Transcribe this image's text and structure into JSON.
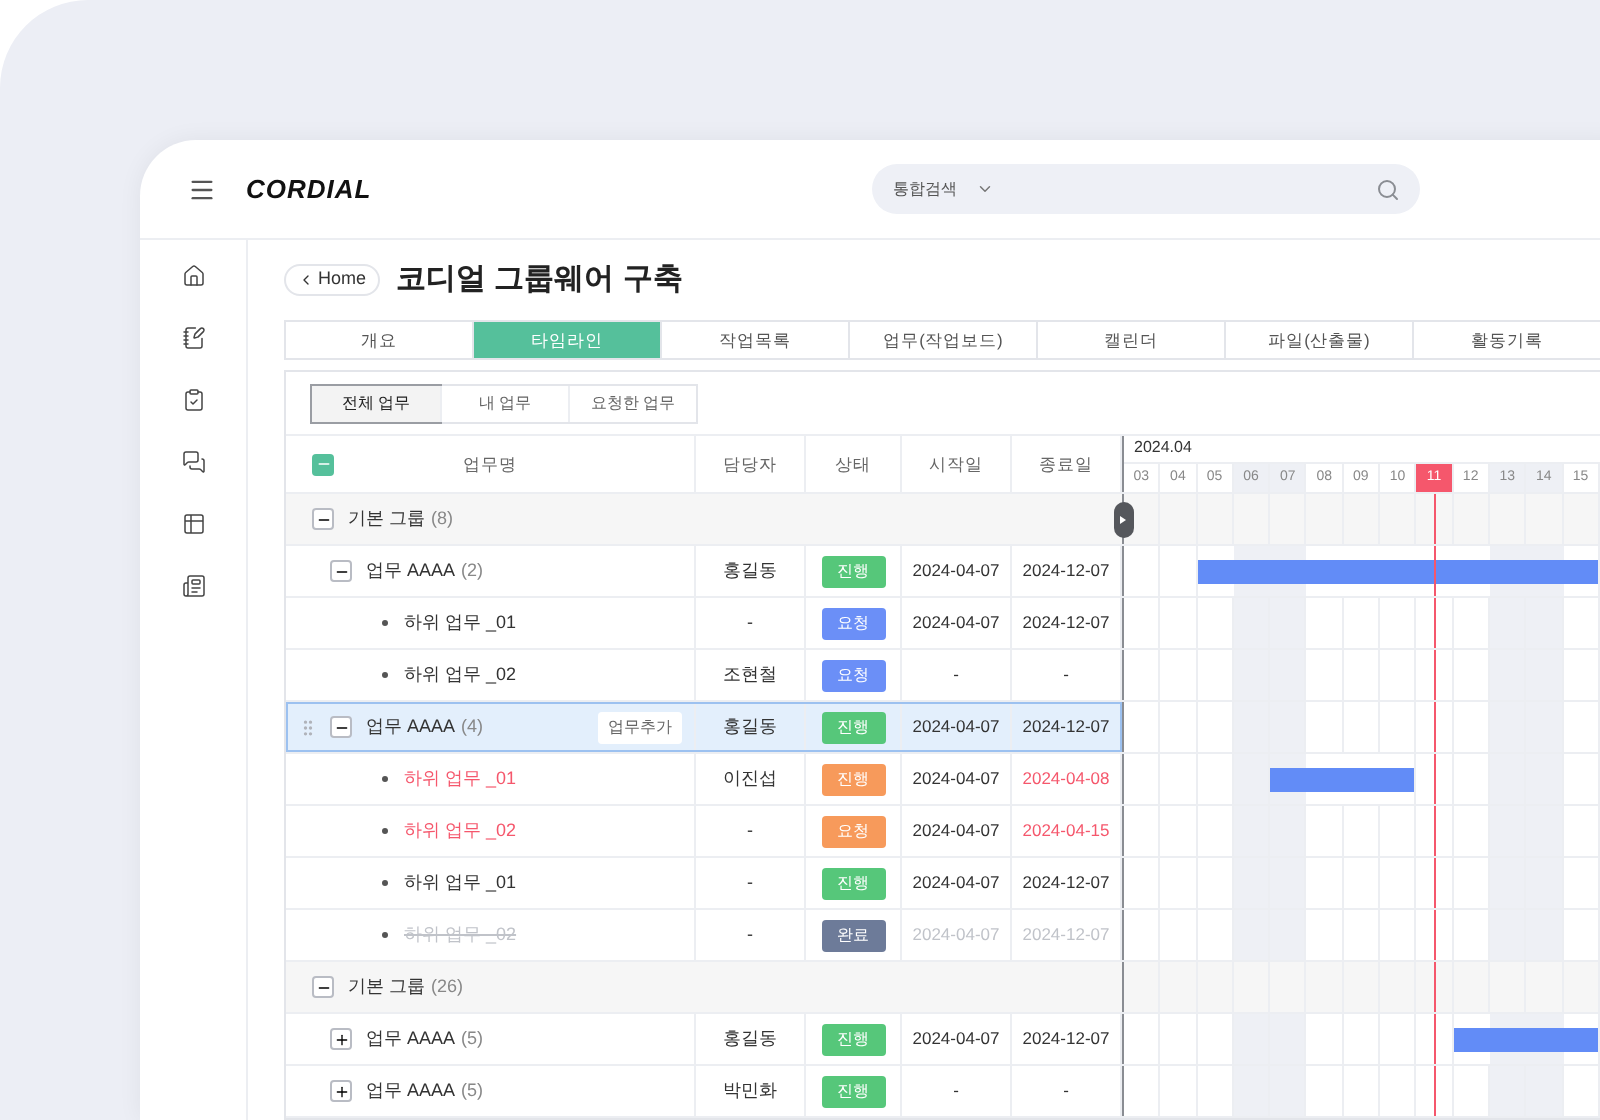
{
  "header": {
    "logo": "CORDIAL",
    "search": {
      "scope": "통합검색"
    }
  },
  "breadcrumb": {
    "back_label": "Home"
  },
  "page_title": "코디얼 그룹웨어 구축",
  "tabs": [
    {
      "label": "개요",
      "selected": false
    },
    {
      "label": "타임라인",
      "selected": true
    },
    {
      "label": "작업목록",
      "selected": false
    },
    {
      "label": "업무(작업보드)",
      "selected": false
    },
    {
      "label": "캘린더",
      "selected": false
    },
    {
      "label": "파일(산출물)",
      "selected": false
    },
    {
      "label": "활동기록",
      "selected": false
    }
  ],
  "filters": [
    {
      "label": "전체 업무",
      "selected": true
    },
    {
      "label": "내 업무",
      "selected": false
    },
    {
      "label": "요청한 업무",
      "selected": false
    }
  ],
  "table": {
    "select_all": {
      "checked": true
    },
    "columns": [
      "업무명",
      "담당자",
      "상태",
      "시작일",
      "종료일"
    ],
    "groups": [
      {
        "name": "기본 그룹",
        "count": "(8)",
        "expanded": true,
        "children": [
          {
            "name": "업무 AAAA",
            "count": "(2)",
            "expanded": true,
            "selected": false,
            "assignee": "홍길동",
            "status": {
              "label": "진행",
              "color": "#56c77a"
            },
            "start": "2024-04-07",
            "end": "2024-12-07",
            "bar": [
              false,
              false,
              true,
              true,
              true,
              true,
              true,
              true,
              true,
              true,
              true,
              true,
              true
            ],
            "children": [
              {
                "name": "하위 업무 _01",
                "selected": false,
                "overdue": false,
                "done": false,
                "assignee": "-",
                "status": {
                  "label": "요청",
                  "color": "#6b8ff7"
                },
                "start": "2024-04-07",
                "end": "2024-12-07"
              },
              {
                "name": "하위 업무 _02",
                "selected": false,
                "overdue": false,
                "done": false,
                "assignee": "조현철",
                "status": {
                  "label": "요청",
                  "color": "#6b8ff7"
                },
                "start": "-",
                "end": "-"
              }
            ]
          },
          {
            "name": "업무 AAAA",
            "count": "(4)",
            "expanded": true,
            "selected": true,
            "add_button": "업무추가",
            "assignee": "홍길동",
            "status": {
              "label": "진행",
              "color": "#56c77a"
            },
            "start": "2024-04-07",
            "end": "2024-12-07",
            "children": [
              {
                "name": "하위 업무 _01",
                "selected": false,
                "overdue": true,
                "done": false,
                "assignee": "이진섭",
                "status": {
                  "label": "진행",
                  "color": "#f79a5b"
                },
                "start": "2024-04-07",
                "end": "2024-04-08",
                "bar": [
                  false,
                  false,
                  false,
                  false,
                  true,
                  true,
                  true,
                  true,
                  false,
                  false,
                  false,
                  false,
                  false
                ]
              },
              {
                "name": "하위 업무 _02",
                "selected": false,
                "overdue": true,
                "done": false,
                "assignee": "-",
                "status": {
                  "label": "요청",
                  "color": "#f79a5b"
                },
                "start": "2024-04-07",
                "end": "2024-04-15"
              },
              {
                "name": "하위 업무 _01",
                "selected": false,
                "overdue": false,
                "done": false,
                "assignee": "-",
                "status": {
                  "label": "진행",
                  "color": "#56c77a"
                },
                "start": "2024-04-07",
                "end": "2024-12-07"
              },
              {
                "name": "하위 업무 _02",
                "selected": false,
                "overdue": false,
                "done": true,
                "assignee": "-",
                "status": {
                  "label": "완료",
                  "color": "#6d7b99"
                },
                "start": "2024-04-07",
                "end": "2024-12-07"
              }
            ]
          }
        ]
      },
      {
        "name": "기본 그룹",
        "count": "(26)",
        "expanded": true,
        "children": [
          {
            "name": "업무 AAAA",
            "count": "(5)",
            "expanded": false,
            "selected": false,
            "assignee": "홍길동",
            "status": {
              "label": "진행",
              "color": "#56c77a"
            },
            "start": "2024-04-07",
            "end": "2024-12-07",
            "bar": [
              false,
              false,
              false,
              false,
              false,
              false,
              false,
              false,
              false,
              true,
              true,
              true,
              true
            ]
          },
          {
            "name": "업무 AAAA",
            "count": "(5)",
            "expanded": false,
            "selected": false,
            "assignee": "박민화",
            "status": {
              "label": "진행",
              "color": "#56c77a"
            },
            "start": "-",
            "end": "-"
          }
        ]
      }
    ]
  },
  "gantt": {
    "month": "2024.04",
    "days": [
      {
        "label": "03",
        "weekend": false,
        "today": false
      },
      {
        "label": "04",
        "weekend": false,
        "today": false
      },
      {
        "label": "05",
        "weekend": false,
        "today": false
      },
      {
        "label": "06",
        "weekend": true,
        "today": false
      },
      {
        "label": "07",
        "weekend": true,
        "today": false
      },
      {
        "label": "08",
        "weekend": false,
        "today": false
      },
      {
        "label": "09",
        "weekend": false,
        "today": false
      },
      {
        "label": "10",
        "weekend": false,
        "today": false
      },
      {
        "label": "11",
        "weekend": false,
        "today": true
      },
      {
        "label": "12",
        "weekend": false,
        "today": false
      },
      {
        "label": "13",
        "weekend": true,
        "today": false
      },
      {
        "label": "14",
        "weekend": true,
        "today": false
      },
      {
        "label": "15",
        "weekend": false,
        "today": false
      }
    ]
  }
}
